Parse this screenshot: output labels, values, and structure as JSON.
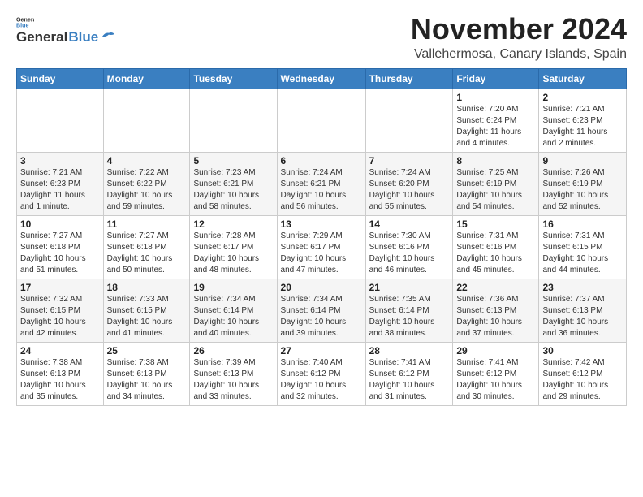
{
  "header": {
    "logo_general": "General",
    "logo_blue": "Blue",
    "month_title": "November 2024",
    "location": "Vallehermosa, Canary Islands, Spain"
  },
  "days_of_week": [
    "Sunday",
    "Monday",
    "Tuesday",
    "Wednesday",
    "Thursday",
    "Friday",
    "Saturday"
  ],
  "weeks": [
    [
      {
        "day": "",
        "info": ""
      },
      {
        "day": "",
        "info": ""
      },
      {
        "day": "",
        "info": ""
      },
      {
        "day": "",
        "info": ""
      },
      {
        "day": "",
        "info": ""
      },
      {
        "day": "1",
        "info": "Sunrise: 7:20 AM\nSunset: 6:24 PM\nDaylight: 11 hours and 4 minutes."
      },
      {
        "day": "2",
        "info": "Sunrise: 7:21 AM\nSunset: 6:23 PM\nDaylight: 11 hours and 2 minutes."
      }
    ],
    [
      {
        "day": "3",
        "info": "Sunrise: 7:21 AM\nSunset: 6:23 PM\nDaylight: 11 hours and 1 minute."
      },
      {
        "day": "4",
        "info": "Sunrise: 7:22 AM\nSunset: 6:22 PM\nDaylight: 10 hours and 59 minutes."
      },
      {
        "day": "5",
        "info": "Sunrise: 7:23 AM\nSunset: 6:21 PM\nDaylight: 10 hours and 58 minutes."
      },
      {
        "day": "6",
        "info": "Sunrise: 7:24 AM\nSunset: 6:21 PM\nDaylight: 10 hours and 56 minutes."
      },
      {
        "day": "7",
        "info": "Sunrise: 7:24 AM\nSunset: 6:20 PM\nDaylight: 10 hours and 55 minutes."
      },
      {
        "day": "8",
        "info": "Sunrise: 7:25 AM\nSunset: 6:19 PM\nDaylight: 10 hours and 54 minutes."
      },
      {
        "day": "9",
        "info": "Sunrise: 7:26 AM\nSunset: 6:19 PM\nDaylight: 10 hours and 52 minutes."
      }
    ],
    [
      {
        "day": "10",
        "info": "Sunrise: 7:27 AM\nSunset: 6:18 PM\nDaylight: 10 hours and 51 minutes."
      },
      {
        "day": "11",
        "info": "Sunrise: 7:27 AM\nSunset: 6:18 PM\nDaylight: 10 hours and 50 minutes."
      },
      {
        "day": "12",
        "info": "Sunrise: 7:28 AM\nSunset: 6:17 PM\nDaylight: 10 hours and 48 minutes."
      },
      {
        "day": "13",
        "info": "Sunrise: 7:29 AM\nSunset: 6:17 PM\nDaylight: 10 hours and 47 minutes."
      },
      {
        "day": "14",
        "info": "Sunrise: 7:30 AM\nSunset: 6:16 PM\nDaylight: 10 hours and 46 minutes."
      },
      {
        "day": "15",
        "info": "Sunrise: 7:31 AM\nSunset: 6:16 PM\nDaylight: 10 hours and 45 minutes."
      },
      {
        "day": "16",
        "info": "Sunrise: 7:31 AM\nSunset: 6:15 PM\nDaylight: 10 hours and 44 minutes."
      }
    ],
    [
      {
        "day": "17",
        "info": "Sunrise: 7:32 AM\nSunset: 6:15 PM\nDaylight: 10 hours and 42 minutes."
      },
      {
        "day": "18",
        "info": "Sunrise: 7:33 AM\nSunset: 6:15 PM\nDaylight: 10 hours and 41 minutes."
      },
      {
        "day": "19",
        "info": "Sunrise: 7:34 AM\nSunset: 6:14 PM\nDaylight: 10 hours and 40 minutes."
      },
      {
        "day": "20",
        "info": "Sunrise: 7:34 AM\nSunset: 6:14 PM\nDaylight: 10 hours and 39 minutes."
      },
      {
        "day": "21",
        "info": "Sunrise: 7:35 AM\nSunset: 6:14 PM\nDaylight: 10 hours and 38 minutes."
      },
      {
        "day": "22",
        "info": "Sunrise: 7:36 AM\nSunset: 6:13 PM\nDaylight: 10 hours and 37 minutes."
      },
      {
        "day": "23",
        "info": "Sunrise: 7:37 AM\nSunset: 6:13 PM\nDaylight: 10 hours and 36 minutes."
      }
    ],
    [
      {
        "day": "24",
        "info": "Sunrise: 7:38 AM\nSunset: 6:13 PM\nDaylight: 10 hours and 35 minutes."
      },
      {
        "day": "25",
        "info": "Sunrise: 7:38 AM\nSunset: 6:13 PM\nDaylight: 10 hours and 34 minutes."
      },
      {
        "day": "26",
        "info": "Sunrise: 7:39 AM\nSunset: 6:13 PM\nDaylight: 10 hours and 33 minutes."
      },
      {
        "day": "27",
        "info": "Sunrise: 7:40 AM\nSunset: 6:12 PM\nDaylight: 10 hours and 32 minutes."
      },
      {
        "day": "28",
        "info": "Sunrise: 7:41 AM\nSunset: 6:12 PM\nDaylight: 10 hours and 31 minutes."
      },
      {
        "day": "29",
        "info": "Sunrise: 7:41 AM\nSunset: 6:12 PM\nDaylight: 10 hours and 30 minutes."
      },
      {
        "day": "30",
        "info": "Sunrise: 7:42 AM\nSunset: 6:12 PM\nDaylight: 10 hours and 29 minutes."
      }
    ]
  ]
}
